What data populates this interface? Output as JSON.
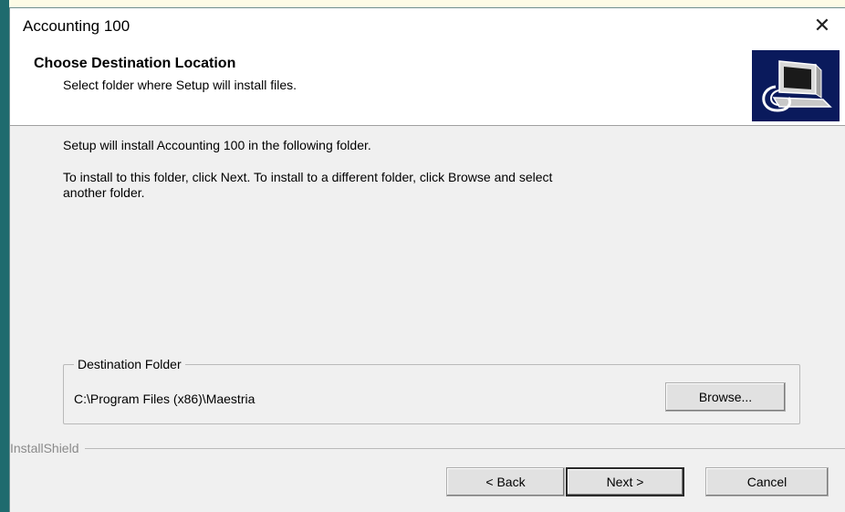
{
  "window": {
    "title": "Accounting 100",
    "close_glyph": "✕"
  },
  "header": {
    "title": "Choose Destination Location",
    "subtitle": "Select folder where Setup will install files.",
    "logo_icon": "installshield-computer-icon"
  },
  "body": {
    "line1": "Setup will install Accounting 100 in the following folder.",
    "line2a": "To install to this folder, click Next. To install to a different folder, click Browse and select",
    "line2b": "another folder."
  },
  "destination": {
    "legend": "Destination Folder",
    "path": "C:\\Program Files (x86)\\Maestria",
    "browse_label": "Browse..."
  },
  "footer": {
    "brand": "InstallShield",
    "back_label": "< Back",
    "next_label": "Next >",
    "cancel_label": "Cancel"
  },
  "colors": {
    "accent_strip": "#1f6b6e",
    "logo_bg": "#0a1a5c",
    "dialog_bg": "#f0f0f0"
  }
}
